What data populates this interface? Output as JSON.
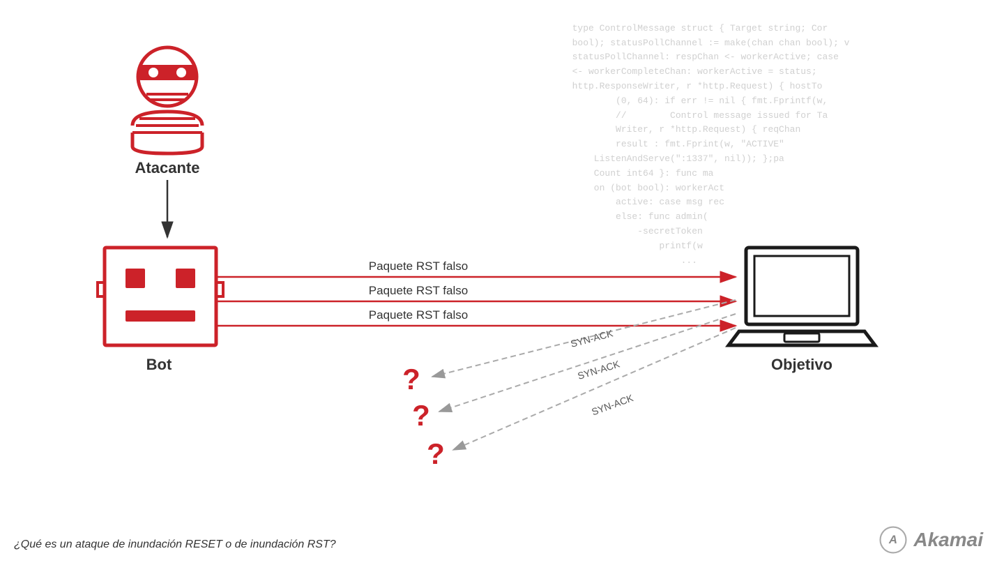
{
  "code": {
    "lines": [
      "type ControlMessage struct { Target string; Cor",
      "bool); statusPollChannel := make(chan chan bool); v",
      "statusPollChannel: respChan <- workerActive; case",
      "<- workerCompleteChan: workerActive = status;",
      "http.ResponseWriter, r *http.Request) { hostTo",
      "        (0, 64): if err != nil { fmt.Fprintf(w,",
      "        //        Control message issued for Ta",
      "        Writer, r *http.Request) { reqChan",
      "        result : fmt.Fprint(w, \"ACTIVE\"",
      "    ListenAndServe(\":1337\", nil)); };pa",
      "    Count int64 }: func ma",
      "    on (bot bool): workerAct",
      "        active: case msg rec",
      "        else: func admin(",
      "            -secretToken",
      "                printf(w",
      "                    ..."
    ]
  },
  "attacker": {
    "label": "Atacante"
  },
  "bot": {
    "label": "Bot"
  },
  "objective": {
    "label": "Objetivo"
  },
  "packets": [
    "Paquete RST falso",
    "Paquete RST falso",
    "Paquete RST falso"
  ],
  "syn_acks": [
    "SYN-ACK",
    "SYN-ACK",
    "SYN-ACK"
  ],
  "bottom_question": "¿Qué es un ataque de inundación RESET o de inundación RST?",
  "akamai_label": "Akamai",
  "colors": {
    "red": "#cc2229",
    "dark": "#1a1a1a",
    "gray": "#999999",
    "light_gray": "#cccccc"
  }
}
